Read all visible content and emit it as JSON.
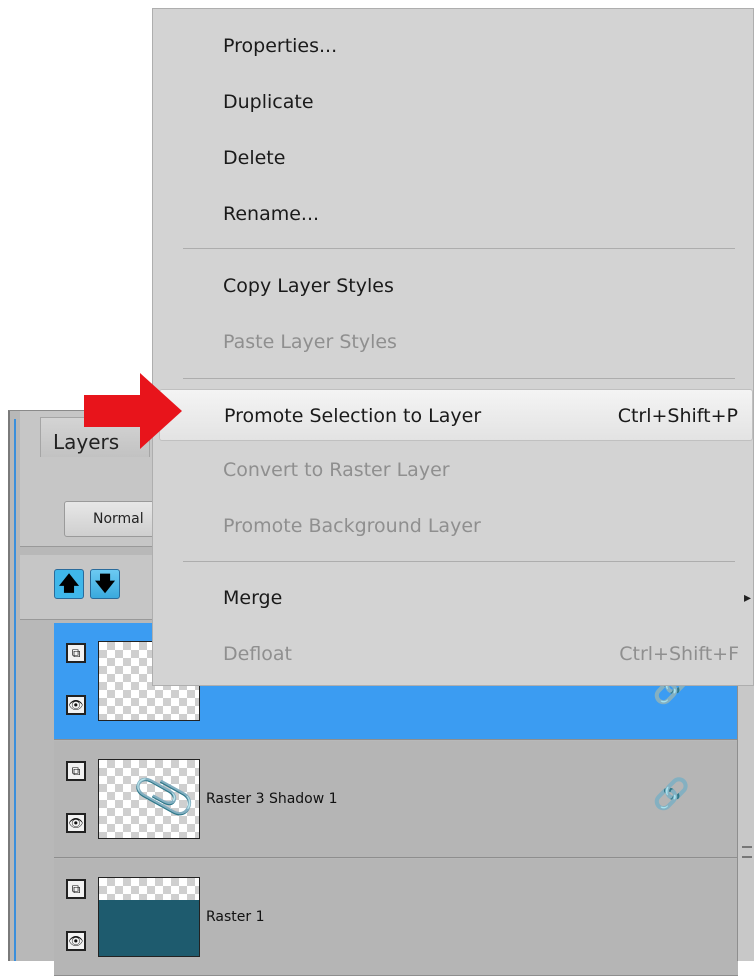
{
  "menu": {
    "items": [
      {
        "label": "Properties...",
        "enabled": true
      },
      {
        "label": "Duplicate",
        "enabled": true
      },
      {
        "label": "Delete",
        "enabled": true
      },
      {
        "label": "Rename...",
        "enabled": true
      },
      {
        "label": "Copy Layer Styles",
        "enabled": true
      },
      {
        "label": "Paste Layer Styles",
        "enabled": false
      },
      {
        "label": "Promote Selection to Layer",
        "shortcut": "Ctrl+Shift+P",
        "enabled": true,
        "highlighted": true
      },
      {
        "label": "Convert to Raster Layer",
        "enabled": false
      },
      {
        "label": "Promote Background Layer",
        "enabled": false
      },
      {
        "label": "Merge",
        "enabled": true,
        "submenu": true
      },
      {
        "label": "Defloat",
        "shortcut": "Ctrl+Shift+F",
        "enabled": false
      }
    ],
    "submenu_arrow": "▸"
  },
  "layers": {
    "title": "Layers",
    "blend_mode": "Normal",
    "rows": [
      {
        "name": "",
        "selected": true
      },
      {
        "name": "Raster 3 Shadow 1",
        "selected": false
      },
      {
        "name": "Raster 1",
        "selected": false
      }
    ]
  },
  "icons": {
    "move_up": "🡅",
    "move_down": "🡇",
    "layer_group": "⧉",
    "visibility": "👁",
    "link": "🔗",
    "clip": "📎"
  },
  "colors": {
    "selection_blue": "#3b9cf2",
    "arrow_red": "#e8141b",
    "menu_bg": "#d3d3d3",
    "disabled_text": "#8f8f8f"
  }
}
